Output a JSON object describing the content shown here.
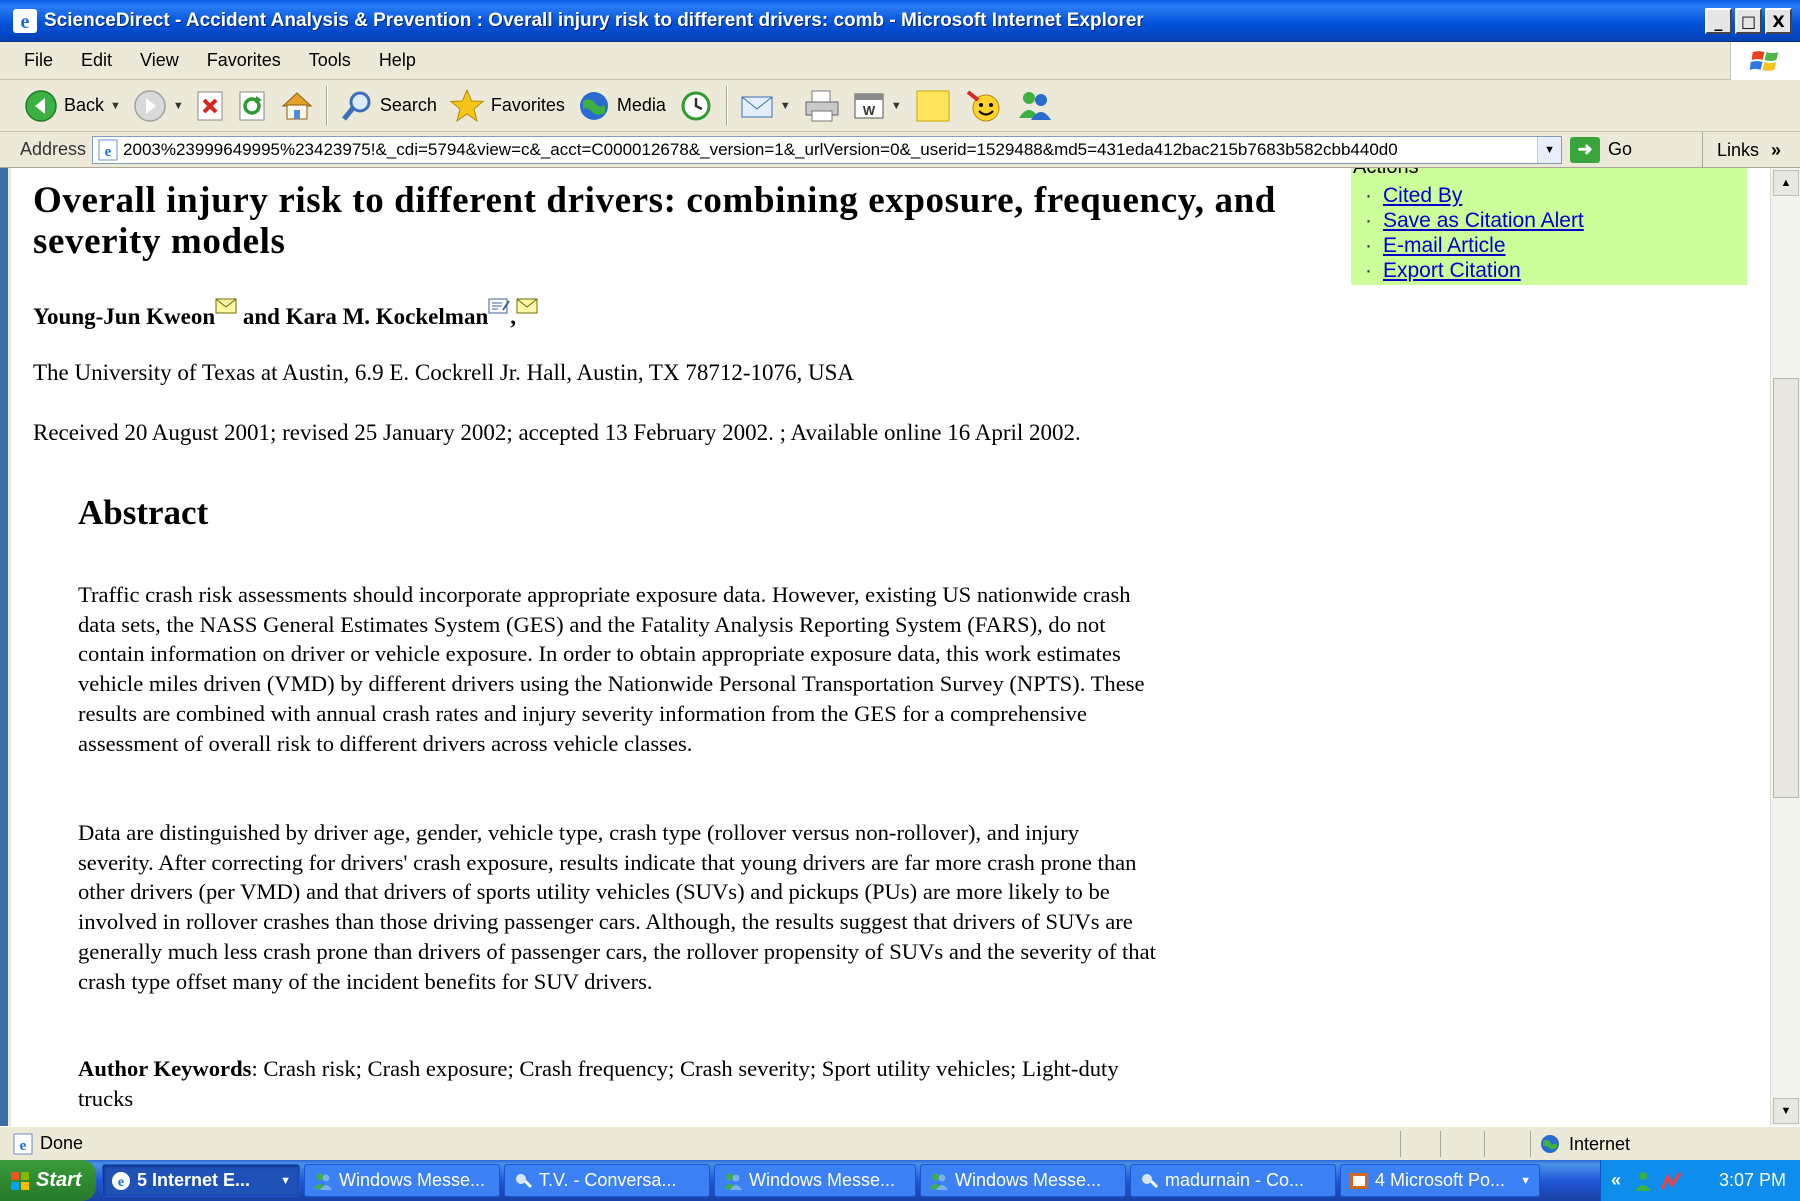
{
  "window": {
    "title": "ScienceDirect - Accident Analysis & Prevention : Overall injury risk to different drivers: comb - Microsoft Internet Explorer",
    "minimize": "_",
    "maximize": "□",
    "close": "X"
  },
  "menu": [
    "File",
    "Edit",
    "View",
    "Favorites",
    "Tools",
    "Help"
  ],
  "toolbar": {
    "back": "Back",
    "search": "Search",
    "favorites": "Favorites",
    "media": "Media"
  },
  "address": {
    "label": "Address",
    "url": "2003%23999649995%23423975!&_cdi=5794&view=c&_acct=C000012678&_version=1&_urlVersion=0&_userid=1529488&md5=431eda412bac215b7683b582cbb440d0",
    "go": "Go",
    "links": "Links",
    "links_chevron": "»"
  },
  "article": {
    "title": "Overall injury risk to different drivers: combining exposure, frequency, and severity models",
    "author1": "Young-Jun Kweon",
    "author_join": " and ",
    "author2": "Kara M. Kockelman",
    "author_comma": ",",
    "affiliation": "The University of Texas at Austin, 6.9 E. Cockrell Jr. Hall, Austin, TX 78712-1076, USA",
    "history": "Received 20 August 2001;  revised 25 January 2002;  accepted 13 February 2002. ; Available online 16 April 2002.",
    "abstract_heading": "Abstract",
    "abstract_p1": "Traffic crash risk assessments should incorporate appropriate exposure data. However, existing US nationwide crash data sets, the NASS General Estimates System (GES) and the Fatality Analysis Reporting System (FARS), do not contain information on driver or vehicle exposure. In order to obtain appropriate exposure data, this work estimates vehicle miles driven (VMD) by different drivers using the Nationwide Personal Transportation Survey (NPTS). These results are combined with annual crash rates and injury severity information from the GES for a comprehensive assessment of overall risk to different drivers across vehicle classes.",
    "abstract_p2": "Data are distinguished by driver age, gender, vehicle type, crash type (rollover versus non-rollover), and injury severity. After correcting for drivers' crash exposure, results indicate that young drivers are far more crash prone than other drivers (per VMD) and that drivers of sports utility vehicles (SUVs) and pickups (PUs) are more likely to be involved in rollover crashes than those driving passenger cars. Although, the results suggest that drivers of SUVs are generally much less crash prone than drivers of passenger cars, the rollover propensity of SUVs and the severity of that crash type offset many of the incident benefits for SUV drivers.",
    "keywords_label": "Author Keywords",
    "keywords": ": Crash risk; Crash exposure; Crash frequency; Crash severity; Sport utility vehicles; Light-duty trucks"
  },
  "actions": {
    "header": "Actions",
    "items": [
      "Cited By",
      "Save as Citation Alert",
      "E-mail Article",
      "Export Citation"
    ]
  },
  "status": {
    "text": "Done",
    "zone": "Internet"
  },
  "taskbar": {
    "start": "Start",
    "tasks": [
      "5 Internet E...",
      "Windows Messe...",
      "T.V. - Conversa...",
      "Windows Messe...",
      "Windows Messe...",
      "madurnain - Co...",
      "4 Microsoft Po..."
    ],
    "tray_chevron": "«",
    "clock": "3:07 PM"
  },
  "colors": {
    "titlebar": "#0453d9",
    "chrome": "#ece9d8",
    "actions_panel": "#ccff99",
    "link": "#0000cc",
    "taskbar": "#2157d7",
    "start_button": "#2f8a2f"
  }
}
